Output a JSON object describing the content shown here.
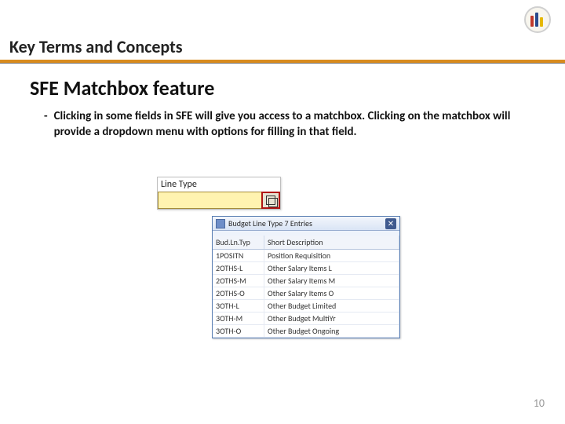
{
  "header": "Key Terms and Concepts",
  "section_title": "SFE Matchbox feature",
  "bullet_text": "Clicking in some fields in SFE will give you access to a matchbox. Clicking on the matchbox will provide a dropdown menu with options for filling in that field.",
  "line_type": {
    "label": "Line Type",
    "field_value": ""
  },
  "dropdown": {
    "title": "Budget Line Type 7 Entries",
    "close_glyph": "✕",
    "headers": {
      "code": "Bud.Ln.Typ",
      "desc": "Short Description"
    },
    "rows": [
      {
        "code": "1POSITN",
        "desc": "Position Requisition"
      },
      {
        "code": "2OTHS-L",
        "desc": "Other Salary Items L"
      },
      {
        "code": "2OTHS-M",
        "desc": "Other Salary Items M"
      },
      {
        "code": "2OTHS-O",
        "desc": "Other Salary Items O"
      },
      {
        "code": "3OTH-L",
        "desc": "Other Budget Limited"
      },
      {
        "code": "3OTH-M",
        "desc": "Other Budget MultiYr"
      },
      {
        "code": "3OTH-O",
        "desc": "Other Budget Ongoing"
      }
    ]
  },
  "page_number": "10"
}
